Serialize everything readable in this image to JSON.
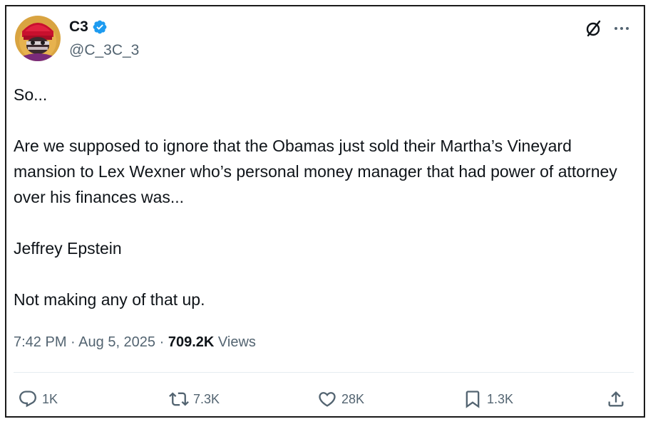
{
  "author": {
    "display_name": "C3",
    "handle": "@C_3C_3",
    "verified": true,
    "verified_color": "#1d9bf0"
  },
  "header_icons": [
    "grok-icon",
    "more-icon"
  ],
  "tweet": {
    "paragraphs": [
      "So...",
      "Are we supposed to ignore that the Obamas just sold their Martha’s Vineyard mansion to Lex Wexner who’s personal money manager that had power of attorney over his finances was...",
      "Jeffrey Epstein",
      "Not making any of that up."
    ]
  },
  "meta": {
    "time": "7:42 PM",
    "date": "Aug 5, 2025",
    "sep": "·",
    "views_count": "709.2K",
    "views_label": "Views"
  },
  "actions": {
    "reply": {
      "icon": "reply-icon",
      "count": "1K"
    },
    "repost": {
      "icon": "repost-icon",
      "count": "7.3K"
    },
    "like": {
      "icon": "heart-icon",
      "count": "28K"
    },
    "bookmark": {
      "icon": "bookmark-icon",
      "count": "1.3K"
    },
    "share": {
      "icon": "share-icon"
    }
  },
  "colors": {
    "text": "#0f1419",
    "secondary": "#536471",
    "divider": "#e6ecf0"
  }
}
